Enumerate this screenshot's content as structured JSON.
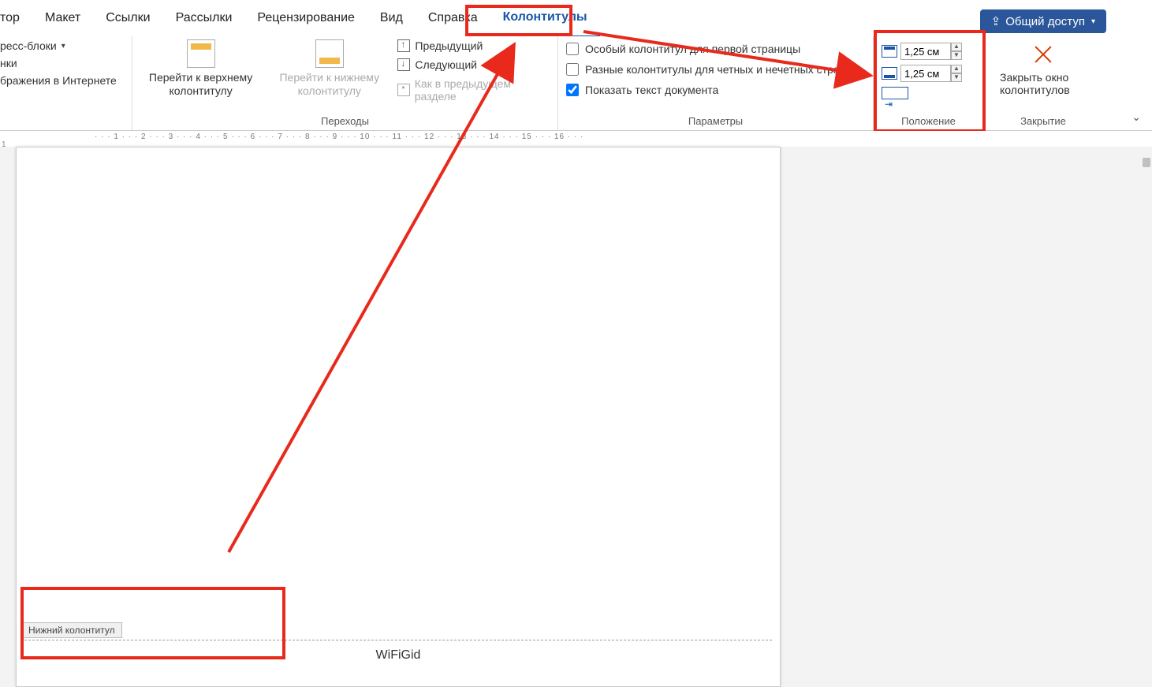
{
  "tabs": {
    "t0": "тор",
    "t1": "Макет",
    "t2": "Ссылки",
    "t3": "Рассылки",
    "t4": "Рецензирование",
    "t5": "Вид",
    "t6": "Справка",
    "t7": "Колонтитулы"
  },
  "share": {
    "label": "Общий доступ"
  },
  "left": {
    "i0": "ресс-блоки",
    "i1": "нки",
    "i2": "бражения в Интернете"
  },
  "nav_group": {
    "top_btn": "Перейти к верхнему колонтитулу",
    "bot_btn": "Перейти к нижнему колонтитулу",
    "prev": "Предыдущий",
    "next": "Следующий",
    "link": "Как в предыдущем разделе",
    "label": "Переходы"
  },
  "params_group": {
    "c0": "Особый колонтитул для первой страницы",
    "c1": "Разные колонтитулы для четных и нечетных страниц",
    "c2": "Показать текст документа",
    "c2_checked": true,
    "label": "Параметры"
  },
  "pos_group": {
    "v0": "1,25 см",
    "v1": "1,25 см",
    "label": "Положение"
  },
  "close_group": {
    "btn": "Закрыть окно колонтитулов",
    "label": "Закрытие"
  },
  "ruler": {
    "vmark": "1",
    "text": "· · · 1 · · · 2 · · · 3 · · · 4 · · · 5 · · · 6 · · · 7 · · · 8 · · · 9 · · · 10 · · · 11 · · · 12 · · · 13 · · · 14 · · · 15 · · · 16 · · ·"
  },
  "footer": {
    "tag": "Нижний колонтитул",
    "text": "WiFiGid"
  }
}
